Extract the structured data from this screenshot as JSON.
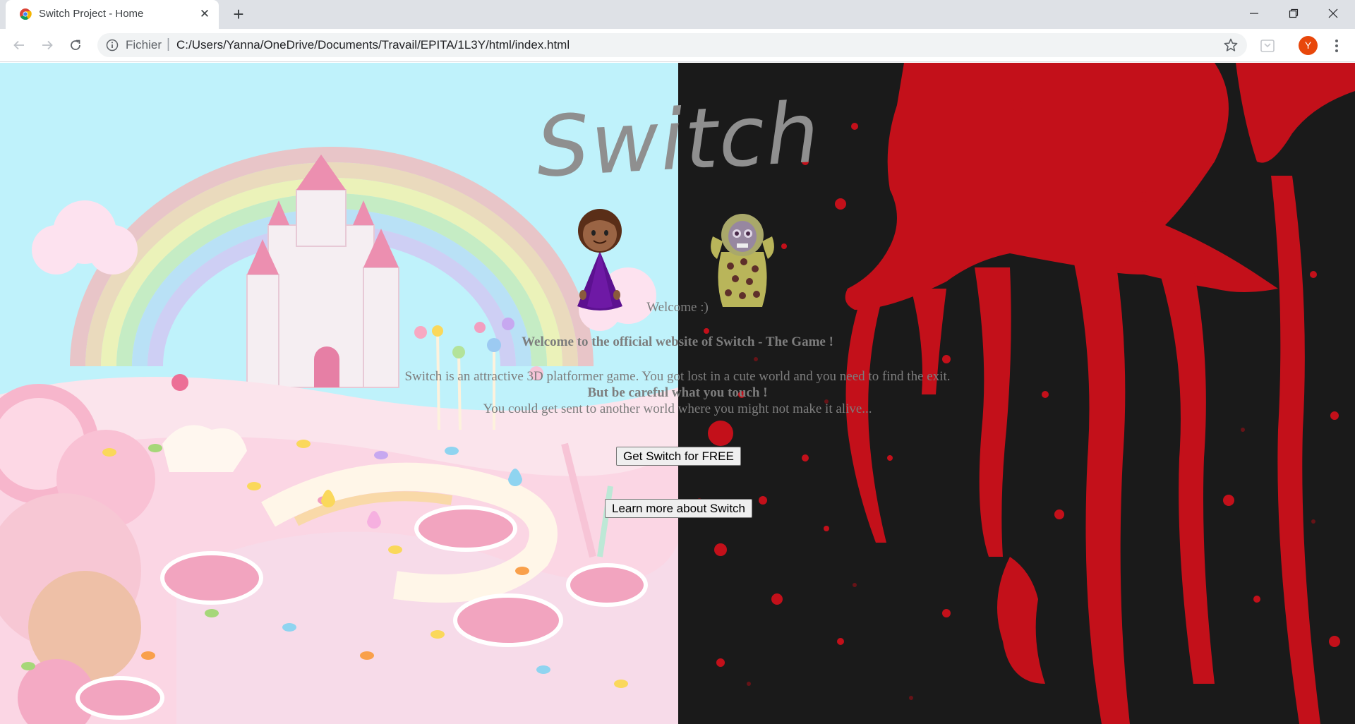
{
  "browser": {
    "tab_title": "Switch Project - Home",
    "scheme_label": "Fichier",
    "url": "C:/Users/Yanna/OneDrive/Documents/Travail/EPITA/1L3Y/html/index.html",
    "avatar_letter": "Y"
  },
  "page": {
    "logo": "Switch",
    "welcome": "Welcome :)",
    "headline": "Welcome to the official website of Switch - The Game !",
    "description": "Switch is an attractive 3D platformer game. You got lost in a cute world and you need to find the exit.",
    "warning": "But be careful what you touch !",
    "subtext": "You could get sent to another world where you might not make it alive...",
    "download_button": "Get Switch for FREE",
    "learn_button": "Learn more about Switch"
  },
  "colors": {
    "candy_sky": "#bff2fb",
    "blood_bg": "#1a1a1a",
    "blood_red": "#c3101a",
    "avatar": "#e8470b"
  }
}
